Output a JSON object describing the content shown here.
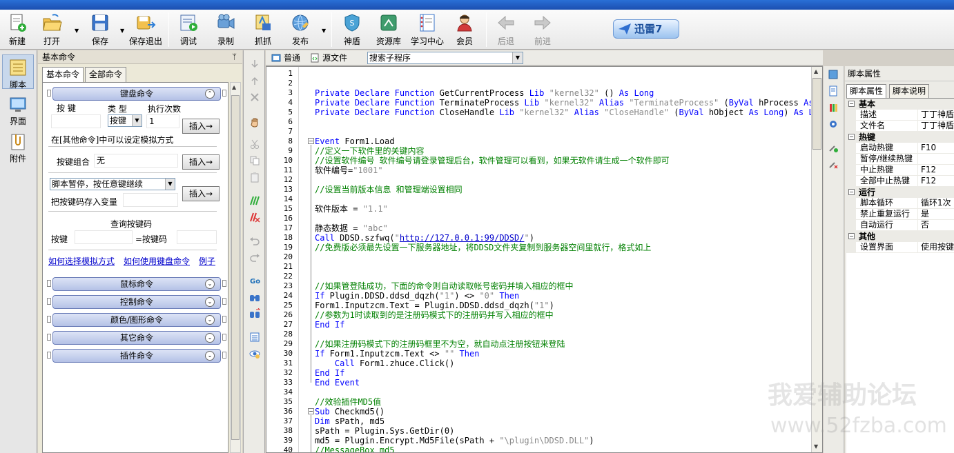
{
  "toolbar": {
    "items": [
      {
        "label": "新建",
        "icon": "new-file-icon"
      },
      {
        "label": "打开",
        "icon": "open-folder-icon"
      },
      {
        "label": "保存",
        "icon": "save-icon"
      },
      {
        "label": "保存退出",
        "icon": "save-exit-icon"
      },
      {
        "label": "调试",
        "icon": "debug-icon"
      },
      {
        "label": "录制",
        "icon": "record-icon"
      },
      {
        "label": "抓抓",
        "icon": "capture-icon"
      },
      {
        "label": "发布",
        "icon": "publish-icon"
      },
      {
        "label": "神盾",
        "icon": "shield-icon"
      },
      {
        "label": "资源库",
        "icon": "resource-library-icon"
      },
      {
        "label": "学习中心",
        "icon": "learning-center-icon"
      },
      {
        "label": "会员",
        "icon": "member-icon"
      },
      {
        "label": "后退",
        "icon": "back-arrow-icon"
      },
      {
        "label": "前进",
        "icon": "forward-arrow-icon"
      }
    ],
    "xunlei_label": "迅雷7"
  },
  "left_strip": {
    "items": [
      {
        "label": "脚本",
        "icon": "script-icon"
      },
      {
        "label": "界面",
        "icon": "interface-icon"
      },
      {
        "label": "附件",
        "icon": "attachment-icon"
      }
    ]
  },
  "command_panel": {
    "title": "基本命令",
    "pin": "ᛘ",
    "tabs": [
      "基本命令",
      "全部命令"
    ],
    "keyboard": {
      "header": "键盘命令",
      "col_key": "按 键",
      "col_type": "类 型",
      "col_times": "执行次数",
      "type_value": "按键",
      "times_value": "1",
      "insert_label": "插入→",
      "note": "在[其他命令]中可以设定模拟方式",
      "combo_label": "按键组合",
      "combo_value": "无",
      "pause_option": "脚本暂停，按任意键继续",
      "store_label": "把按键码存入变量",
      "query_title": "查询按键码",
      "query_key_label": "按键",
      "query_code_label": "=按键码",
      "links": [
        "如何选择模拟方式",
        "如何使用键盘命令",
        "例子"
      ]
    },
    "sections": [
      "鼠标命令",
      "控制命令",
      "颜色/图形命令",
      "其它命令",
      "插件命令"
    ]
  },
  "editor": {
    "tab_normal": "普通",
    "tab_source": "源文件",
    "search_value": "搜索子程序",
    "line_numbers": [
      "1",
      "2",
      "3",
      "4",
      "5",
      "6",
      "7",
      "8",
      "9",
      "10",
      "11",
      "12",
      "13",
      "14",
      "15",
      "16",
      "17",
      "18",
      "19",
      "20",
      "21",
      "22",
      "23",
      "24",
      "25",
      "26",
      "27",
      "28",
      "29",
      "30",
      "31",
      "32",
      "33",
      "34",
      "35",
      "36",
      "37",
      "38",
      "39",
      "40"
    ],
    "lines": [
      "",
      "",
      "Private Declare Function GetCurrentProcess Lib \"kernel32\" () As Long",
      "Private Declare Function TerminateProcess Lib \"kernel32\" Alias \"TerminateProcess\" (ByVal hProcess As Lo",
      "Private Declare Function CloseHandle Lib \"kernel32\" Alias \"CloseHandle\" (ByVal hObject As Long) As Long",
      "",
      "",
      "Event Form1.Load",
      "//定义一下软件里的关键内容",
      "//设置软件编号 软件编号请登录管理后台，软件管理可以看到，如果无软件请生成一个软件即可",
      "软件编号=\"1001\"",
      "",
      "//设置当前版本信息 和管理端设置相同",
      "",
      "软件版本 = \"1.1\"",
      "",
      "静态数据 = \"abc\"",
      "Call DDSD.szfwq(\"http://127.0.0.1:99/DDSD/\")",
      "//免费版必须最先设置一下服务器地址，将DDSD文件夹复制到服务器空间里就行，格式如上",
      "",
      "",
      "",
      "//如果管登陆成功，下面的命令则自动读取帐号密码并填入相应的框中",
      "If Plugin.DDSD.ddsd_dqzh(\"1\") <> \"0\" Then",
      "Form1.Inputzcm.Text = Plugin.DDSD.ddsd_dqzh(\"1\")",
      "//参数为1时读取到的是注册码模式下的注册码并写入相应的框中",
      "End If",
      "",
      "//如果注册码模式下的注册码框里不为空，就自动点注册按钮来登陆",
      "If Form1.Inputzcm.Text <> \"\" Then",
      "    Call Form1.zhuce.Click()",
      "End If",
      "End Event",
      "",
      "//效验插件MD5值",
      "Sub Checkmd5()",
      "Dim sPath, md5",
      "sPath = Plugin.Sys.GetDir(0)",
      "md5 = Plugin.Encrypt.Md5File(sPath + \"\\plugin\\DDSD.DLL\")",
      "//MessageBox md5"
    ]
  },
  "properties": {
    "title": "脚本属性",
    "tabs": [
      "脚本属性",
      "脚本说明"
    ],
    "groups": [
      {
        "name": "基本",
        "rows": [
          {
            "k": "描述",
            "v": "丁丁神盾"
          },
          {
            "k": "文件名",
            "v": "丁丁神盾"
          }
        ]
      },
      {
        "name": "热键",
        "rows": [
          {
            "k": "启动热键",
            "v": "F10"
          },
          {
            "k": "暂停/继续热键",
            "v": ""
          },
          {
            "k": "中止热键",
            "v": "F12"
          },
          {
            "k": "全部中止热键",
            "v": "F12"
          }
        ]
      },
      {
        "name": "运行",
        "rows": [
          {
            "k": "脚本循环",
            "v": "循环1次"
          },
          {
            "k": "禁止重复运行",
            "v": "是"
          },
          {
            "k": "自动运行",
            "v": "否"
          }
        ]
      },
      {
        "name": "其他",
        "rows": [
          {
            "k": "设置界面",
            "v": "使用按键"
          }
        ]
      }
    ]
  },
  "watermark": {
    "line1": "我爱辅助论坛",
    "line2": "www.52fzba.com"
  },
  "colors": {
    "keyword": "#0000ff",
    "string": "#888888",
    "comment": "#008000",
    "accent": "#1b4fb0"
  }
}
